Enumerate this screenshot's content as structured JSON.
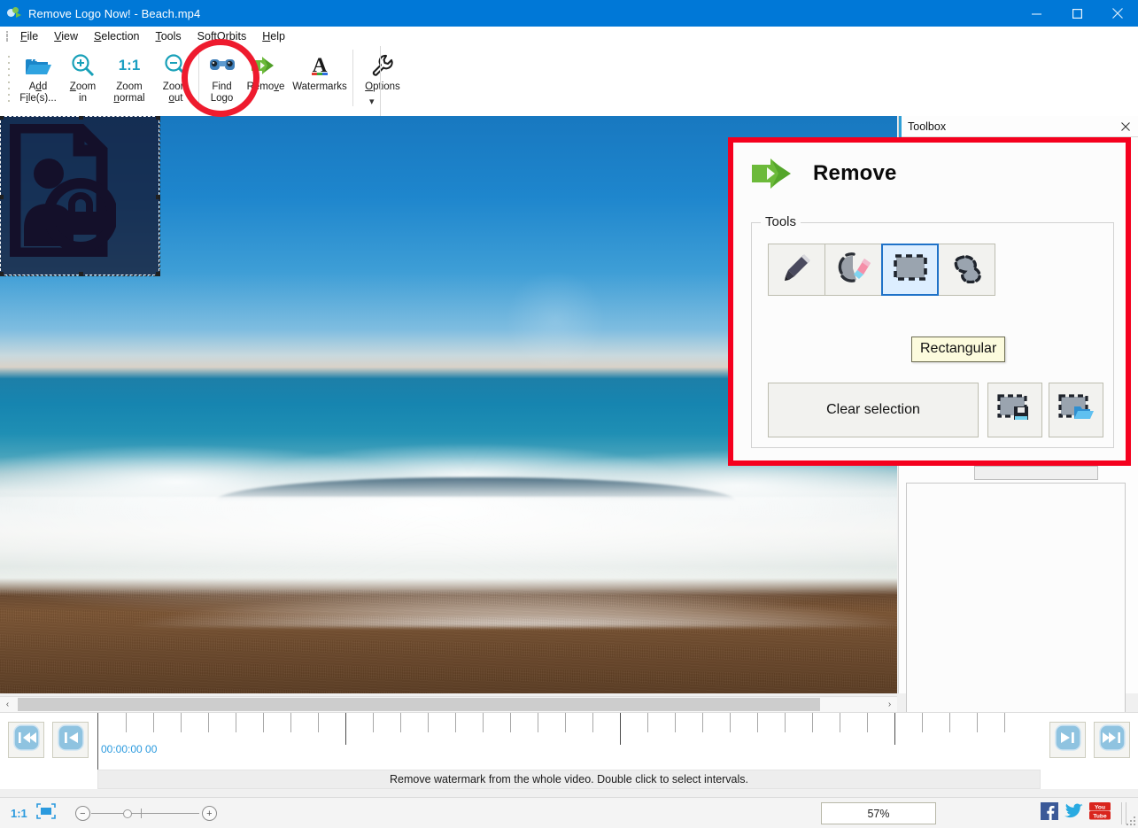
{
  "window": {
    "title": "Remove Logo Now! - Beach.mp4",
    "app_icon": "app-logo-icon",
    "minimize_label": "–",
    "maximize_label": "□",
    "close_label": "✕"
  },
  "menubar": {
    "items": [
      {
        "label": "File",
        "mnemonic": "F"
      },
      {
        "label": "View",
        "mnemonic": "V"
      },
      {
        "label": "Selection",
        "mnemonic": "S"
      },
      {
        "label": "Tools",
        "mnemonic": "T"
      },
      {
        "label": "SoftOrbits",
        "mnemonic": ""
      },
      {
        "label": "Help",
        "mnemonic": "H"
      }
    ]
  },
  "toolbar": {
    "buttons": [
      {
        "name": "add-files",
        "line1": "Add",
        "line2": "File(s)...",
        "icon": "open-folder-icon"
      },
      {
        "name": "zoom-in",
        "line1": "Zoom",
        "line2": "in",
        "icon": "zoom-in-icon"
      },
      {
        "name": "zoom-normal",
        "line1": "Zoom",
        "line2": "normal",
        "icon": "one-to-one-icon"
      },
      {
        "name": "zoom-out",
        "line1": "Zoom",
        "line2": "out",
        "icon": "zoom-out-icon"
      },
      {
        "name": "find-logo",
        "line1": "Find",
        "line2": "Logo",
        "icon": "binoculars-icon"
      },
      {
        "name": "remove-watermarks",
        "line1": "Remove",
        "line2": "Watermarks",
        "icon": "green-arrow-icon"
      },
      {
        "name": "options",
        "line1": "Options",
        "line2": "",
        "icon": "wrench-icon"
      }
    ],
    "overflow_label": "▾"
  },
  "toolbox": {
    "panel_title": "Toolbox",
    "close_label": "✕",
    "heading": "Remove",
    "heading_icon": "green-arrow-icon",
    "group_legend": "Tools",
    "tools": [
      {
        "name": "marker-tool",
        "icon": "marker-pen-icon",
        "selected": false
      },
      {
        "name": "eraser-tool",
        "icon": "eraser-icon",
        "selected": false
      },
      {
        "name": "rectangular-tool",
        "icon": "rectangular-selection-icon",
        "selected": true
      },
      {
        "name": "lasso-tool",
        "icon": "lasso-selection-icon",
        "selected": false
      }
    ],
    "tooltip": "Rectangular",
    "clear_selection_label": "Clear selection",
    "save_selection_icon": "save-selection-icon",
    "load_selection_icon": "load-selection-icon"
  },
  "timeline": {
    "timecode": "00:00:00 00",
    "buttons": [
      {
        "name": "go-to-start-button",
        "icon": "rewind-to-start-icon"
      },
      {
        "name": "previous-frame-button",
        "icon": "previous-frame-icon"
      },
      {
        "name": "next-frame-button",
        "icon": "next-frame-icon"
      },
      {
        "name": "go-to-end-button",
        "icon": "forward-to-end-icon"
      }
    ]
  },
  "status": {
    "hint": "Remove watermark from the whole video. Double click to select intervals."
  },
  "bottombar": {
    "ratio_label": "1:1",
    "fit_icon": "fit-to-screen-icon",
    "zoom_out_label": "−",
    "zoom_in_label": "+",
    "zoom_percent": "57%",
    "social": [
      {
        "name": "facebook-icon",
        "label": "f"
      },
      {
        "name": "twitter-icon",
        "label": ""
      },
      {
        "name": "youtube-icon",
        "label": "You Tube"
      }
    ]
  },
  "scrollbar": {
    "left_arrow": "‹",
    "right_arrow": "›"
  },
  "canvas": {
    "selection_name": "watermark-selection-region",
    "watermark_icon": "document-lock-watermark-icon"
  },
  "annotation": {
    "circle_color": "#ee1b2e",
    "target": "remove-watermarks"
  }
}
